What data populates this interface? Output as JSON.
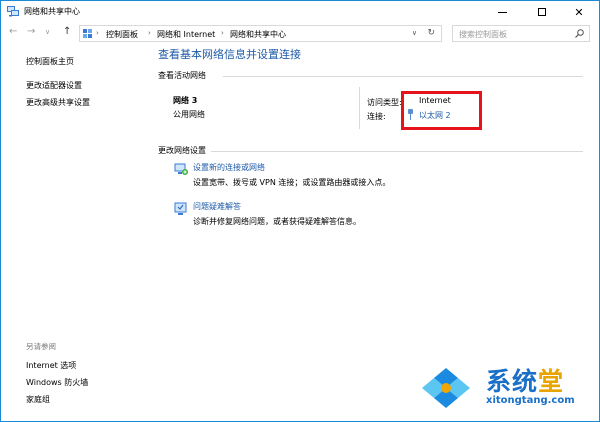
{
  "window": {
    "title": "网络和共享中心"
  },
  "address": {
    "crumbs": [
      "控制面板",
      "网络和 Internet",
      "网络和共享中心"
    ],
    "search_placeholder": "搜索控制面板"
  },
  "left_pane": {
    "home": "控制面板主页",
    "adapter": "更改适配器设置",
    "advanced": "更改高级共享设置",
    "see_also": "另请参阅",
    "internet_options": "Internet 选项",
    "firewall": "Windows 防火墙",
    "homegroup": "家庭组"
  },
  "main": {
    "title": "查看基本网络信息并设置连接",
    "active_networks_header": "查看活动网络",
    "network_name": "网络  3",
    "network_type": "公用网络",
    "access_type_label": "访问类型:",
    "access_type_value": "Internet",
    "connections_label": "连接:",
    "connections_value": "以太网 2",
    "change_settings_header": "更改网络设置",
    "tasks": [
      {
        "link": "设置新的连接或网络",
        "desc": "设置宽带、拨号或 VPN 连接；或设置路由器或接入点。"
      },
      {
        "link": "问题疑难解答",
        "desc": "诊断并修复网络问题，或者获得疑难解答信息。"
      }
    ]
  },
  "watermark": {
    "cn_main": "系统",
    "cn_accent": "堂",
    "en": "xitongtang.com"
  },
  "colors": {
    "link": "#1e5aa8",
    "highlight_box": "#e6131b",
    "window_border": "#1b8ad6"
  }
}
